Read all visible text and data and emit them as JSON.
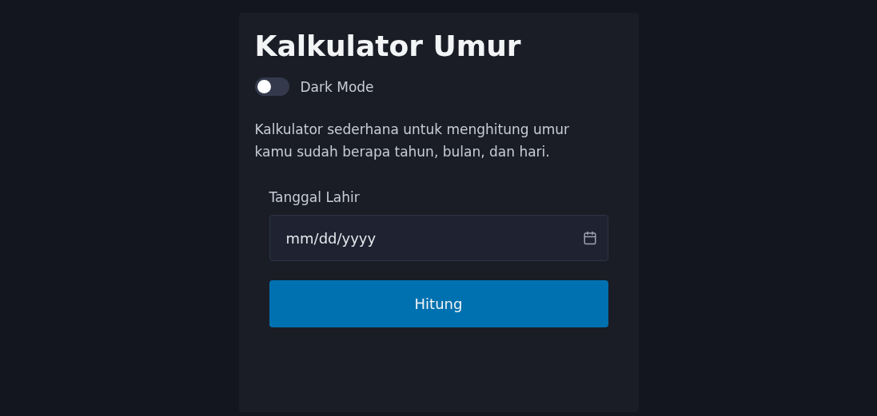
{
  "title": "Kalkulator Umur",
  "dark_mode_toggle": {
    "label": "Dark Mode",
    "on": false
  },
  "description": "Kalkulator sederhana untuk menghitung umur kamu sudah berapa tahun, bulan, dan hari.",
  "birth_date": {
    "label": "Tanggal Lahir",
    "placeholder": "mm/dd/yyyy"
  },
  "buttons": [
    "Hitung"
  ]
}
